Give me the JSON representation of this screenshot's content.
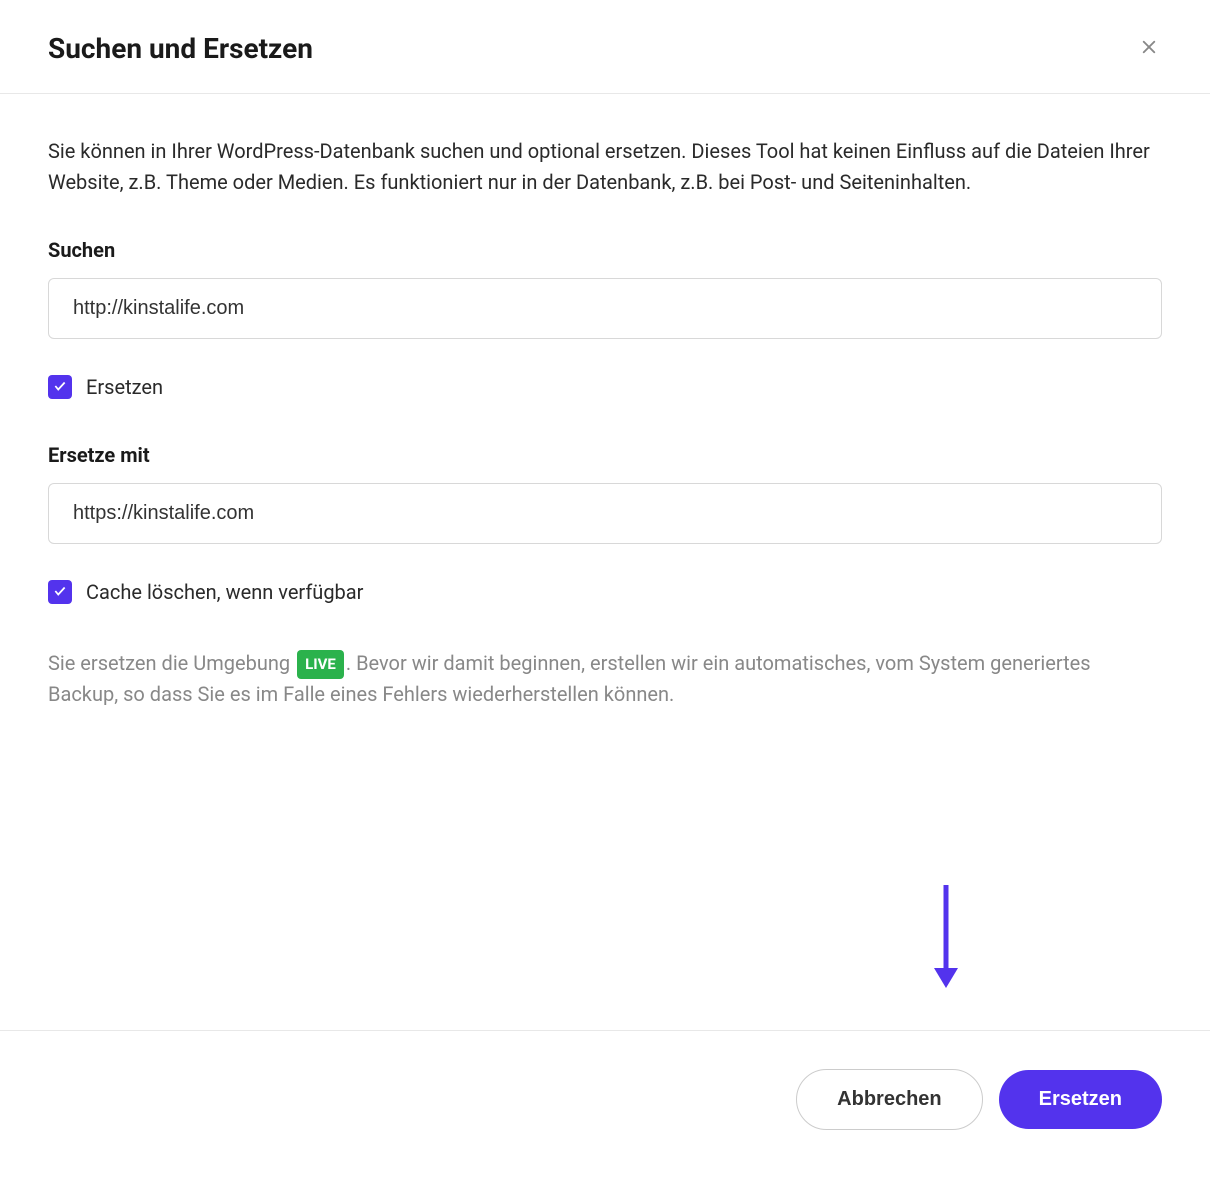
{
  "header": {
    "title": "Suchen und Ersetzen"
  },
  "description": "Sie können in Ihrer WordPress-Datenbank suchen und optional ersetzen. Dieses Tool hat keinen Einfluss auf die Dateien Ihrer Website, z.B. Theme oder Medien. Es funktioniert nur in der Datenbank, z.B. bei Post- und Seiteninhalten.",
  "search": {
    "label": "Suchen",
    "value": "http://kinstalife.com"
  },
  "replace_checkbox": {
    "label": "Ersetzen",
    "checked": true
  },
  "replace_with": {
    "label": "Ersetze mit",
    "value": "https://kinstalife.com"
  },
  "clear_cache_checkbox": {
    "label": "Cache löschen, wenn verfügbar",
    "checked": true
  },
  "info": {
    "prefix": "Sie ersetzen die Umgebung ",
    "badge": "LIVE",
    "suffix": ". Bevor wir damit beginnen, erstellen wir ein automatisches, vom System generiertes Backup, so dass Sie es im Falle eines Fehlers wiederherstellen können."
  },
  "footer": {
    "cancel": "Abbrechen",
    "submit": "Ersetzen"
  }
}
